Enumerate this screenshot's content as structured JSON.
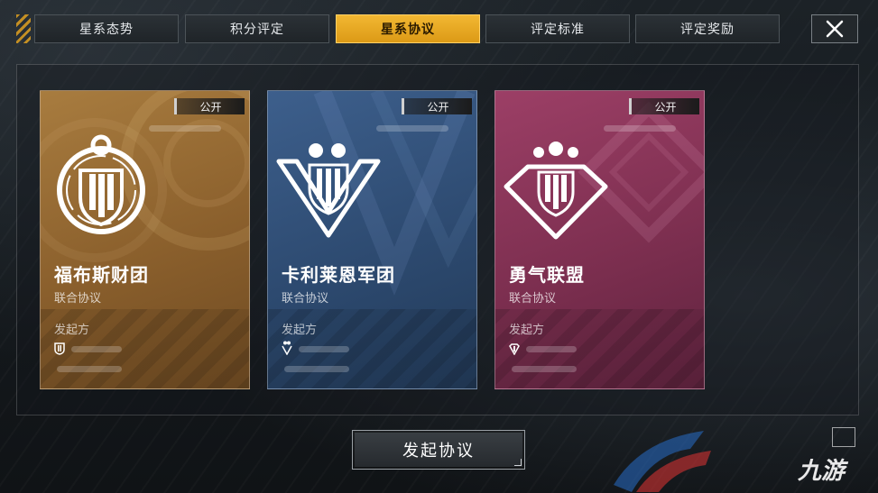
{
  "tabs": [
    {
      "label": "星系态势",
      "active": false
    },
    {
      "label": "积分评定",
      "active": false
    },
    {
      "label": "星系协议",
      "active": true
    },
    {
      "label": "评定标准",
      "active": false
    },
    {
      "label": "评定奖励",
      "active": false
    }
  ],
  "close_icon": "close-x-icon",
  "cards": [
    {
      "badge": "公开",
      "name": "福布斯财团",
      "type": "联合协议",
      "initiator_label": "发起方",
      "emblem": "circle-shield-emblem-icon",
      "theme_color": "#a87c3f"
    },
    {
      "badge": "公开",
      "name": "卡利莱恩军团",
      "type": "联合协议",
      "initiator_label": "发起方",
      "emblem": "chevron-shield-emblem-icon",
      "theme_color": "#3d5f8c"
    },
    {
      "badge": "公开",
      "name": "勇气联盟",
      "type": "联合协议",
      "initiator_label": "发起方",
      "emblem": "diamond-shield-emblem-icon",
      "theme_color": "#9c3f66"
    }
  ],
  "action_button": "发起协议",
  "watermark": {
    "text": "九游"
  },
  "colors": {
    "accent": "#f2b732",
    "gold": "#a87c3f",
    "blue": "#3d5f8c",
    "pink": "#9c3f66"
  }
}
